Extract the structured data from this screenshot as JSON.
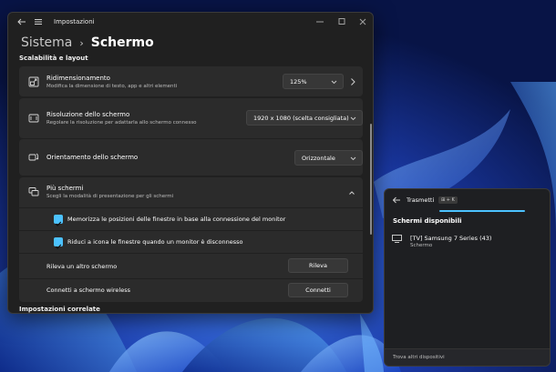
{
  "window": {
    "title": "Impostazioni",
    "breadcrumb_root": "Sistema",
    "breadcrumb_sep": "›",
    "breadcrumb_current": "Schermo"
  },
  "sections": {
    "scale_layout": "Scalabilità e layout",
    "related": "Impostazioni correlate"
  },
  "scaling": {
    "title": "Ridimensionamento",
    "subtitle": "Modifica la dimensione di testo, app e altri elementi",
    "value": "125%"
  },
  "resolution": {
    "title": "Risoluzione dello schermo",
    "subtitle": "Regolare la risoluzione per adattarla allo schermo connesso",
    "value": "1920 x 1080 (scelta consigliata)"
  },
  "orientation": {
    "title": "Orientamento dello schermo",
    "value": "Orizzontale"
  },
  "multi_display": {
    "title": "Più schermi",
    "subtitle": "Scegli la modalità di presentazione per gli schermi",
    "remember_label": "Memorizza le posizioni delle finestre in base alla connessione del monitor",
    "remember_checked": true,
    "minimize_label": "Riduci a icona le finestre quando un monitor è disconnesso",
    "minimize_checked": true,
    "detect_label": "Rileva un altro schermo",
    "detect_button": "Rileva",
    "wireless_label": "Connetti a schermo wireless",
    "wireless_button": "Connetti"
  },
  "cast": {
    "title": "Trasmetti",
    "shortcut": "⊞ + K",
    "heading": "Schermi disponibili",
    "device_name": "[TV] Samsung 7 Series (43)",
    "device_type": "Schermo",
    "footer": "Trova altri dispositivi"
  },
  "colors": {
    "accent": "#4cc2ff",
    "window_bg": "#202020",
    "card_bg": "#2b2b2b"
  },
  "icons": {
    "scaling": "scale-icon",
    "resolution": "resolution-icon",
    "orientation": "orientation-icon",
    "multi_display": "multiple-displays-icon",
    "cast_device": "monitor-icon"
  }
}
